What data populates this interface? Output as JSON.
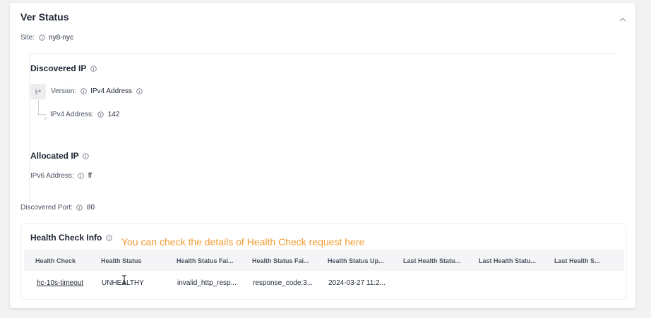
{
  "section": {
    "title": "Ver Status",
    "collapse_icon": "chevron-up-icon"
  },
  "site": {
    "label": "Site:",
    "value": "ny8-nyc"
  },
  "discovered_ip": {
    "title": "Discovered IP",
    "version_label": "Version:",
    "version_value": "IPv4 Address",
    "ipv4_label": "IPv4 Address:",
    "ipv4_value": "142"
  },
  "allocated_ip": {
    "title": "Allocated IP",
    "ipv6_label": "IPv6 Address:",
    "ipv6_value": "ff"
  },
  "discovered_port": {
    "label": "Discovered Port:",
    "value": "80"
  },
  "health_check": {
    "title": "Health Check Info",
    "tooltip": "You can check the details of Health Check request here",
    "columns": [
      "Health Check",
      "Health Status",
      "Health Status Fai...",
      "Health Status Fai...",
      "Health Status Up...",
      "Last Health Statu...",
      "Last Health Statu...",
      "Last Health S..."
    ],
    "rows": [
      {
        "name": "hc-10s-timeout",
        "status": "UNHEALTHY",
        "failure_reason": "invalid_http_resp...",
        "failure_detail": "response_code:3...",
        "updated": "2024-03-27 11:2..."
      }
    ]
  },
  "colors": {
    "accent_tooltip": "#f29a2e",
    "heading": "#1e2433",
    "background": "#f2f2f3"
  }
}
